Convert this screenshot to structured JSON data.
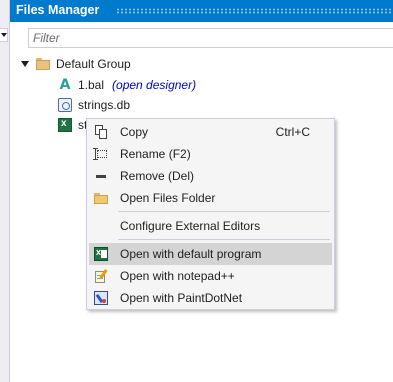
{
  "panel": {
    "title": "Files Manager",
    "filter_placeholder": "Filter"
  },
  "tree": {
    "group": {
      "label": "Default Group"
    },
    "items": [
      {
        "label": "1.bal",
        "hint": "(open designer)",
        "icon": "abc-letter-icon"
      },
      {
        "label": "strings.db",
        "icon": "database-file-icon"
      },
      {
        "label": "st",
        "icon": "excel-file-icon"
      }
    ]
  },
  "context_menu": {
    "items": [
      {
        "label": "Copy",
        "shortcut": "Ctrl+C",
        "icon": "copy-icon"
      },
      {
        "label": "Rename (F2)",
        "icon": "rename-icon"
      },
      {
        "label": "Remove (Del)",
        "icon": "remove-icon"
      },
      {
        "label": "Open Files Folder",
        "icon": "open-folder-icon"
      },
      {
        "label": "Configure External Editors"
      },
      {
        "label": "Open with default program",
        "icon": "excel-icon",
        "highlighted": true
      },
      {
        "label": "Open with notepad++",
        "icon": "notepad-icon"
      },
      {
        "label": "Open with PaintDotNet",
        "icon": "paintdotnet-icon"
      }
    ]
  },
  "colors": {
    "title_bar": "#007acc",
    "menu_background": "#f5f5f5",
    "menu_highlight": "#d4d4d4",
    "hint_text": "#0000cc"
  }
}
